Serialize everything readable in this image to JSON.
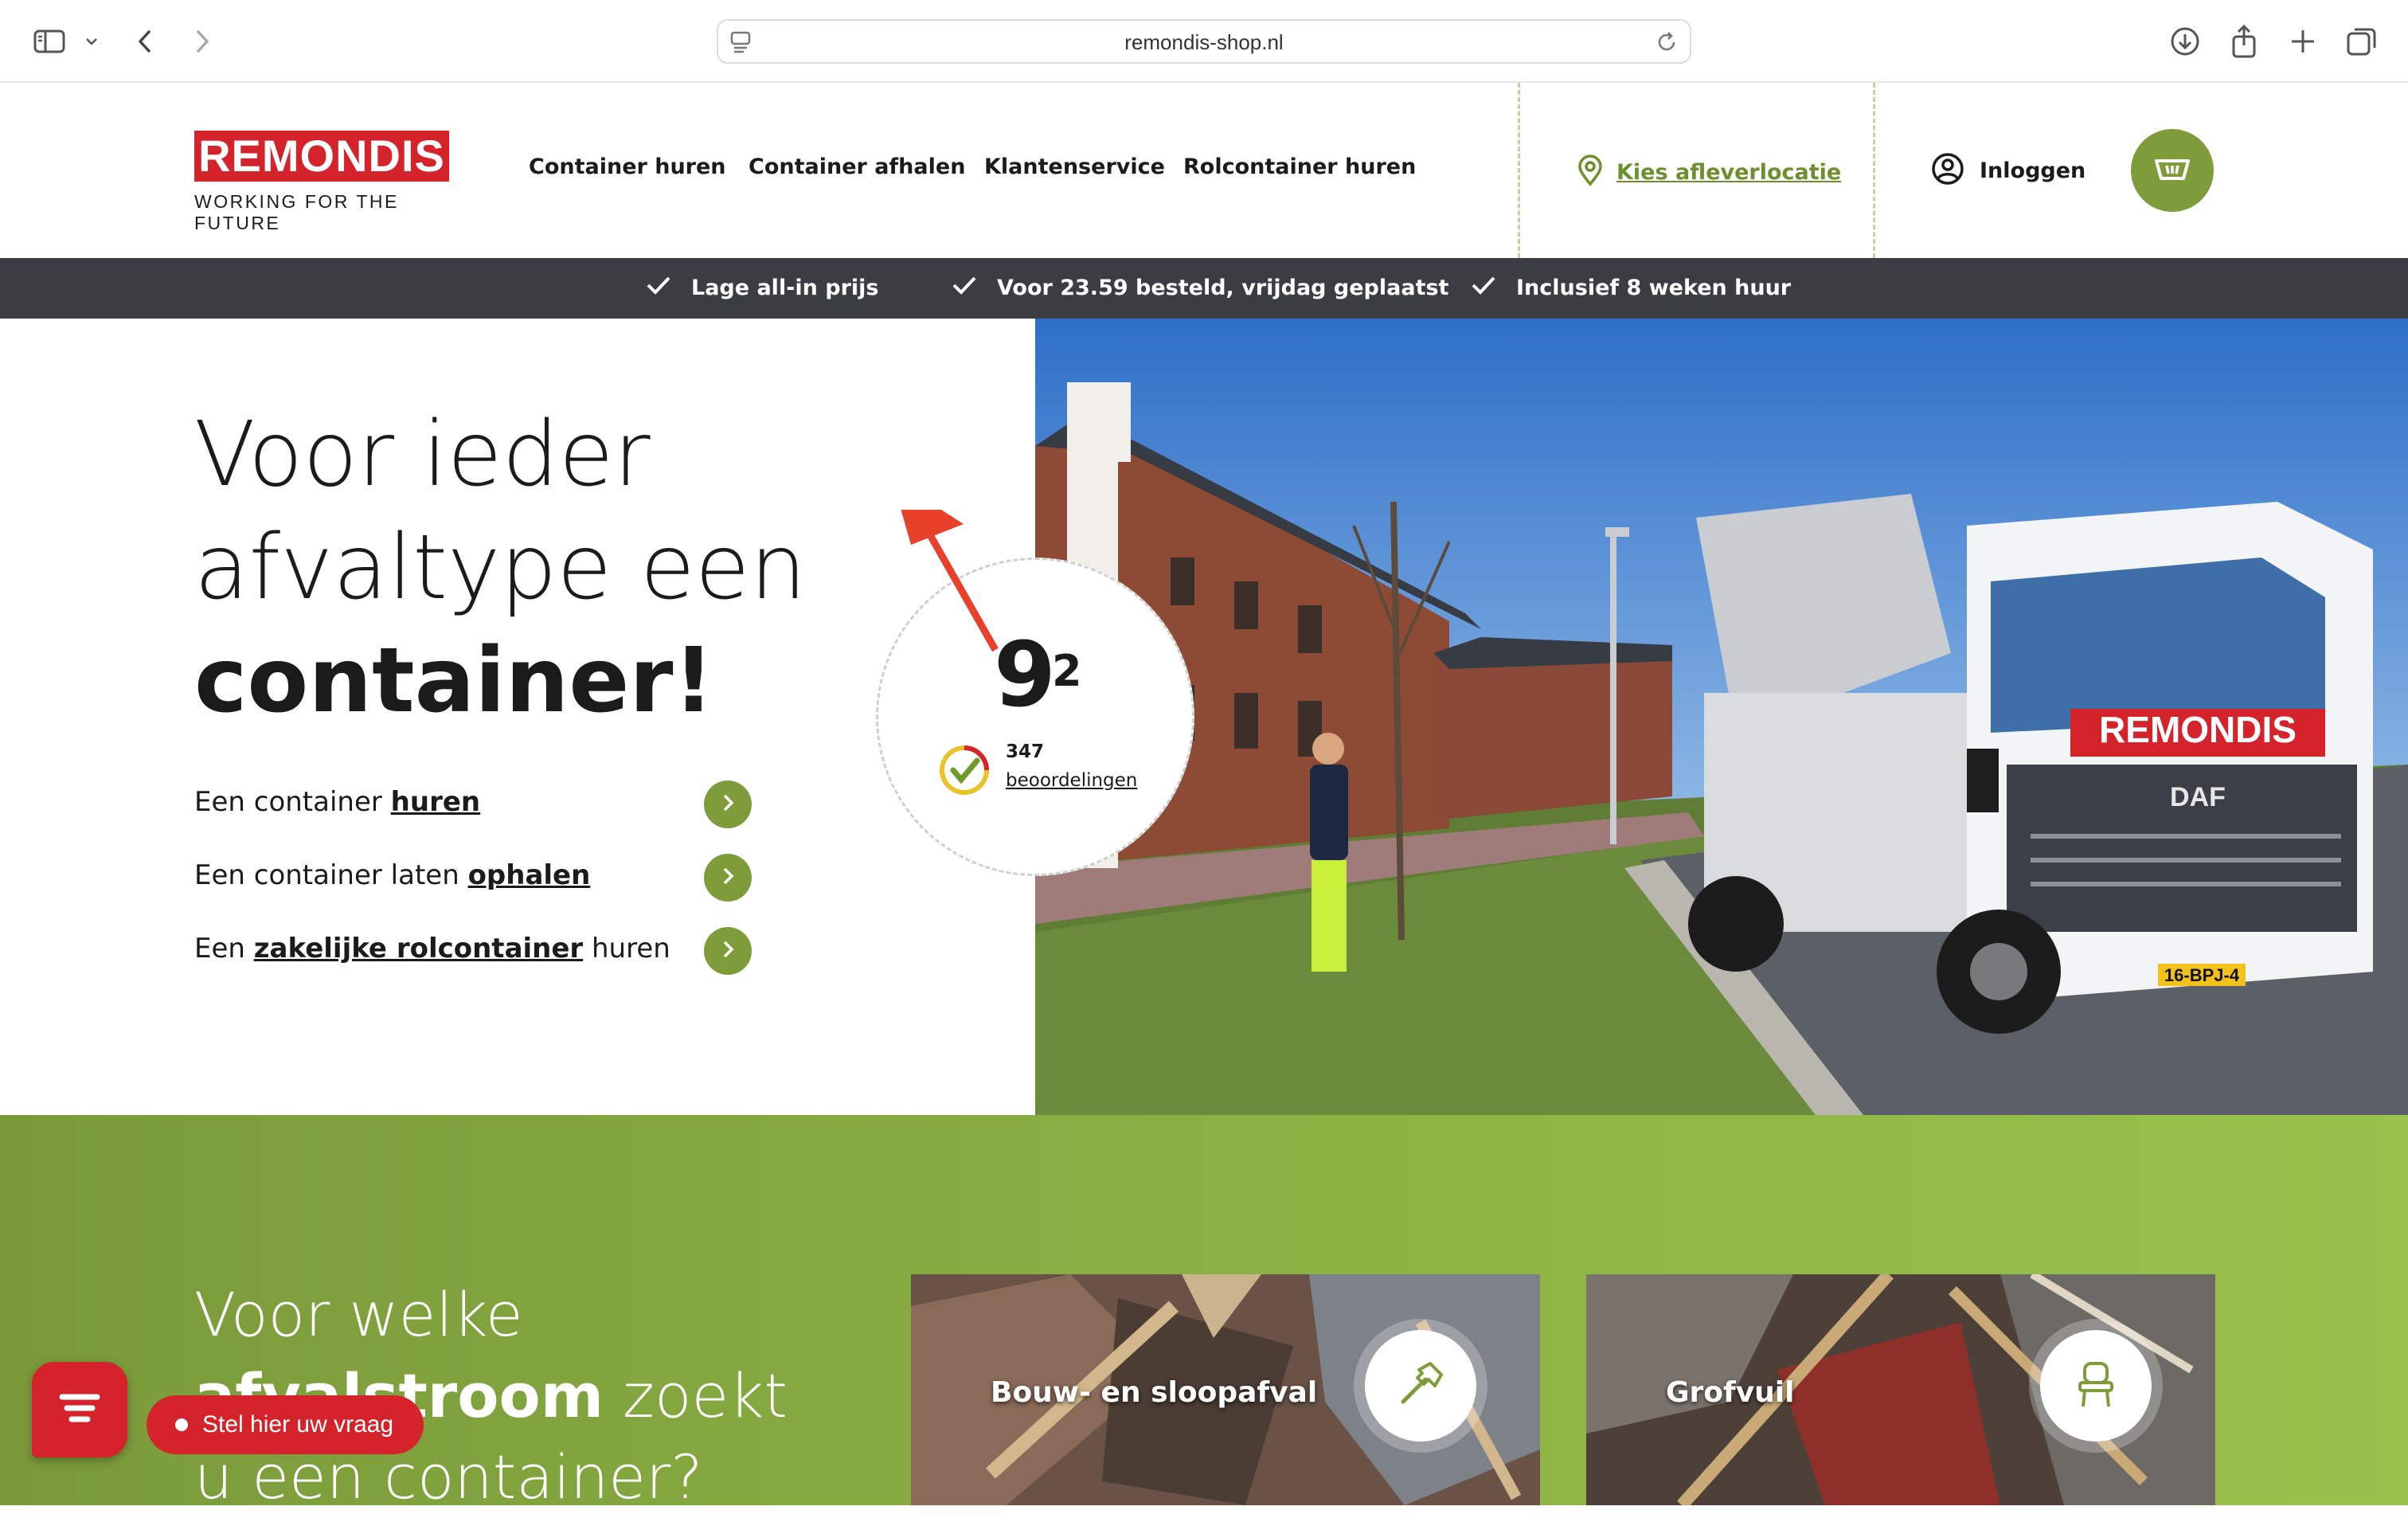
{
  "browser": {
    "url": "remondis-shop.nl"
  },
  "header": {
    "logo_text": "REMONDIS",
    "logo_tagline": "WORKING FOR THE FUTURE",
    "nav": [
      {
        "label": "Container huren"
      },
      {
        "label": "Container afhalen"
      },
      {
        "label": "Klantenservice"
      },
      {
        "label": "Rolcontainer huren"
      }
    ],
    "location_label": "Kies afleverlocatie",
    "login_label": "Inloggen"
  },
  "usp": [
    {
      "label": "Lage all-in prijs"
    },
    {
      "label": "Voor 23.59 besteld, vrijdag geplaatst"
    },
    {
      "label": "Inclusief 8 weken huur"
    }
  ],
  "hero": {
    "title_line1": "Voor ieder",
    "title_line2": "afvaltype een",
    "title_line3": "container!",
    "links": [
      {
        "prefix": "Een container ",
        "bold": "huren",
        "suffix": ""
      },
      {
        "prefix": "Een container laten ",
        "bold": "ophalen",
        "suffix": ""
      },
      {
        "prefix": "Een ",
        "bold": "zakelijke rolcontainer",
        "suffix": " huren"
      }
    ]
  },
  "rating": {
    "score": "9",
    "score_decimal": "2",
    "count": "347",
    "reviews_label": "beoordelingen"
  },
  "photo": {
    "truck_brand": "REMONDIS",
    "truck_make": "DAF",
    "license_plate": "16-BPJ-4"
  },
  "waste_section": {
    "title_pre": "Voor welke",
    "title_bold": "afvalstroom",
    "title_post": " zoekt",
    "title_line3": "u een container?",
    "categories": [
      {
        "label": "Bouw- en sloopafval",
        "icon": "hammer-icon"
      },
      {
        "label": "Grofvuil",
        "icon": "chair-icon"
      }
    ]
  },
  "chat": {
    "label": "Stel hier uw vraag"
  },
  "colors": {
    "brand_red": "#d4232b",
    "brand_green": "#7e9c3a",
    "usp_bar": "#3a3d41"
  }
}
